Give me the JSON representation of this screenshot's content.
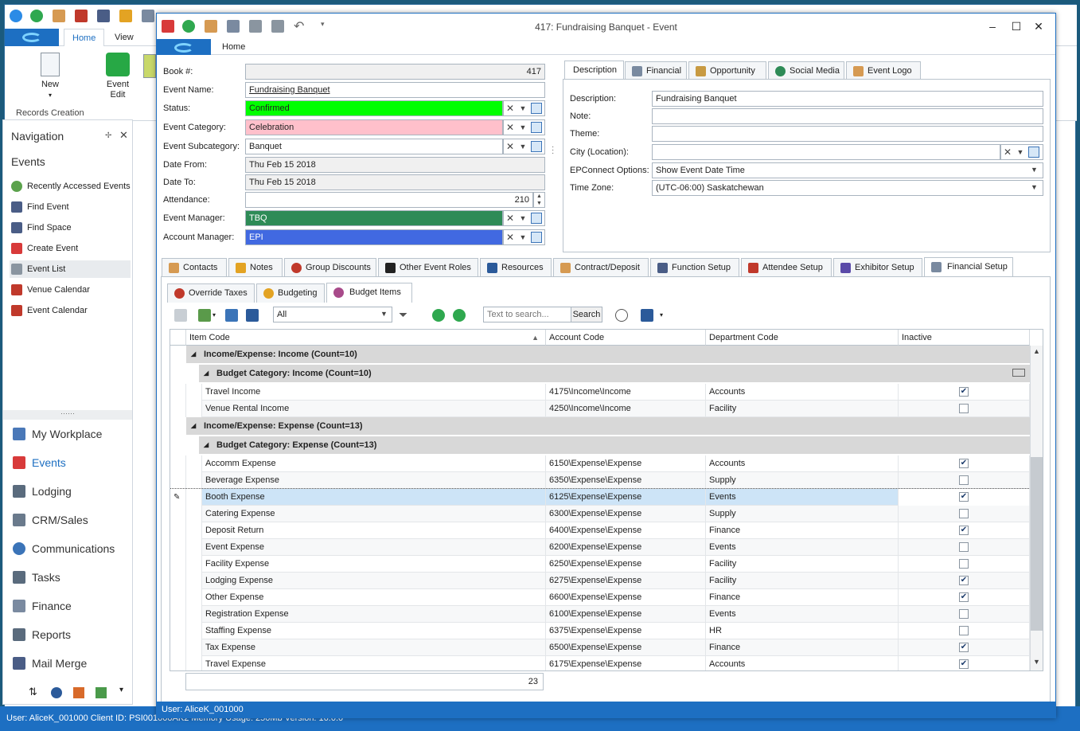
{
  "background_app": {
    "tabs": [
      "Home",
      "View"
    ],
    "ribbon_buttons": [
      {
        "label": "New",
        "icon": "new-document-icon"
      },
      {
        "label": "Event Edit",
        "icon": "event-edit-icon"
      }
    ],
    "ribbon_group": "Records Creation"
  },
  "navigation": {
    "title": "Navigation",
    "section": "Events",
    "items": [
      {
        "label": "Recently Accessed Events",
        "icon": "clock-icon"
      },
      {
        "label": "Find Event",
        "icon": "binoculars-icon"
      },
      {
        "label": "Find Space",
        "icon": "binoculars-icon"
      },
      {
        "label": "Create Event",
        "icon": "pin-icon"
      },
      {
        "label": "Event List",
        "icon": "list-icon"
      },
      {
        "label": "Venue Calendar",
        "icon": "calendar-icon"
      },
      {
        "label": "Event Calendar",
        "icon": "calendar-icon"
      }
    ],
    "modules": [
      {
        "label": "My Workplace",
        "icon": "home-icon"
      },
      {
        "label": "Events",
        "icon": "pin-icon"
      },
      {
        "label": "Lodging",
        "icon": "bed-icon"
      },
      {
        "label": "CRM/Sales",
        "icon": "crm-icon"
      },
      {
        "label": "Communications",
        "icon": "speech-icon"
      },
      {
        "label": "Tasks",
        "icon": "tasks-icon"
      },
      {
        "label": "Finance",
        "icon": "finance-icon"
      },
      {
        "label": "Reports",
        "icon": "reports-icon"
      },
      {
        "label": "Mail Merge",
        "icon": "mail-merge-icon"
      }
    ]
  },
  "status_bar": {
    "text": "User: AliceK_001000    Client ID: PSI001000AK2    Memory Usage: 250Mb    Version: 16.0.0"
  },
  "window": {
    "title": "417: Fundraising Banquet - Event",
    "ribbon_tab": "Home",
    "status_user": "User: AliceK_001000"
  },
  "form": {
    "book_label": "Book #:",
    "book_value": "417",
    "name_label": "Event Name:",
    "name_value": "Fundraising Banquet",
    "status_label": "Status:",
    "status_value": "Confirmed",
    "category_label": "Event Category:",
    "category_value": "Celebration",
    "subcategory_label": "Event Subcategory:",
    "subcategory_value": "Banquet",
    "date_from_label": "Date From:",
    "date_from_value": "Thu Feb 15 2018",
    "date_to_label": "Date To:",
    "date_to_value": "Thu Feb 15 2018",
    "attendance_label": "Attendance:",
    "attendance_value": "210",
    "manager_label": "Event Manager:",
    "manager_value": "TBQ",
    "account_label": "Account Manager:",
    "account_value": "EPI",
    "colors": {
      "status": "#00ff00",
      "category": "#ffc0cb",
      "manager": "#2e8b57",
      "account": "#4169e1"
    }
  },
  "desc_tabs": [
    {
      "label": "Description",
      "icon": ""
    },
    {
      "label": "Financial",
      "icon": "calculator-icon"
    },
    {
      "label": "Opportunity",
      "icon": "opportunity-icon"
    },
    {
      "label": "Social Media",
      "icon": "share-icon"
    },
    {
      "label": "Event Logo",
      "icon": "image-icon"
    }
  ],
  "description": {
    "desc_label": "Description:",
    "desc_value": "Fundraising Banquet",
    "note_label": "Note:",
    "note_value": "",
    "theme_label": "Theme:",
    "theme_value": "",
    "city_label": "City (Location):",
    "city_value": "",
    "epconnect_label": "EPConnect Options:",
    "epconnect_value": "Show Event Date Time",
    "tz_label": "Time Zone:",
    "tz_value": "(UTC-06:00) Saskatchewan"
  },
  "main_tabs": [
    {
      "label": "Contacts",
      "icon": "contacts-icon"
    },
    {
      "label": "Notes",
      "icon": "notes-icon"
    },
    {
      "label": "Group Discounts",
      "icon": "discount-icon"
    },
    {
      "label": "Other Event Roles",
      "icon": "hat-icon"
    },
    {
      "label": "Resources",
      "icon": "resources-icon"
    },
    {
      "label": "Contract/Deposit",
      "icon": "contract-icon"
    },
    {
      "label": "Function Setup",
      "icon": "function-icon"
    },
    {
      "label": "Attendee Setup",
      "icon": "attendee-icon"
    },
    {
      "label": "Exhibitor Setup",
      "icon": "exhibitor-icon"
    },
    {
      "label": "Financial Setup",
      "icon": "calculator-icon"
    }
  ],
  "sub_tabs": [
    {
      "label": "Override Taxes",
      "icon": "no-icon"
    },
    {
      "label": "Budgeting",
      "icon": "budget-icon"
    },
    {
      "label": "Budget Items",
      "icon": "budget-items-icon"
    }
  ],
  "toolbar": {
    "filter_value": "All",
    "search_placeholder": "Text to search...",
    "search_button": "Search"
  },
  "grid": {
    "columns": [
      "Item Code",
      "Account Code",
      "Department Code",
      "Inactive"
    ],
    "groups": [
      {
        "label": "Income/Expense: Income (Count=10)",
        "subgroup": "Budget Category: Income (Count=10)",
        "rows": [
          {
            "item": "Travel Income",
            "account": "4175\\Income\\Income",
            "dept": "Accounts",
            "inactive": true
          },
          {
            "item": "Venue Rental Income",
            "account": "4250\\Income\\Income",
            "dept": "Facility",
            "inactive": false
          }
        ]
      },
      {
        "label": "Income/Expense: Expense (Count=13)",
        "subgroup": "Budget Category: Expense (Count=13)",
        "rows": [
          {
            "item": "Accomm Expense",
            "account": "6150\\Expense\\Expense",
            "dept": "Accounts",
            "inactive": true
          },
          {
            "item": "Beverage Expense",
            "account": "6350\\Expense\\Expense",
            "dept": "Supply",
            "inactive": false
          },
          {
            "item": "Booth Expense",
            "account": "6125\\Expense\\Expense",
            "dept": "Events",
            "inactive": true,
            "selected": true
          },
          {
            "item": "Catering Expense",
            "account": "6300\\Expense\\Expense",
            "dept": "Supply",
            "inactive": false
          },
          {
            "item": "Deposit Return",
            "account": "6400\\Expense\\Expense",
            "dept": "Finance",
            "inactive": true
          },
          {
            "item": "Event Expense",
            "account": "6200\\Expense\\Expense",
            "dept": "Events",
            "inactive": false
          },
          {
            "item": "Facility Expense",
            "account": "6250\\Expense\\Expense",
            "dept": "Facility",
            "inactive": false
          },
          {
            "item": "Lodging Expense",
            "account": "6275\\Expense\\Expense",
            "dept": "Facility",
            "inactive": true
          },
          {
            "item": "Other Expense",
            "account": "6600\\Expense\\Expense",
            "dept": "Finance",
            "inactive": true
          },
          {
            "item": "Registration Expense",
            "account": "6100\\Expense\\Expense",
            "dept": "Events",
            "inactive": false
          },
          {
            "item": "Staffing Expense",
            "account": "6375\\Expense\\Expense",
            "dept": "HR",
            "inactive": false
          },
          {
            "item": "Tax Expense",
            "account": "6500\\Expense\\Expense",
            "dept": "Finance",
            "inactive": true
          },
          {
            "item": "Travel Expense",
            "account": "6175\\Expense\\Expense",
            "dept": "Accounts",
            "inactive": true
          }
        ]
      }
    ],
    "footer_count": "23"
  }
}
